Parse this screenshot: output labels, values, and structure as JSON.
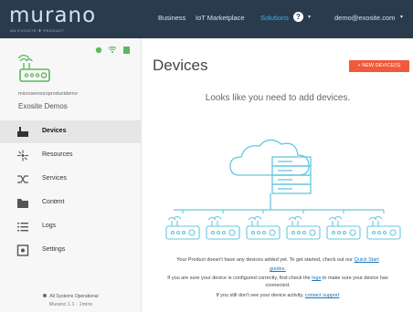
{
  "brand": {
    "name": "murano",
    "tagline": "an exosite ❖ product"
  },
  "nav": {
    "items": [
      "Business",
      "IoT Marketplace",
      "Solutions"
    ],
    "active": "Solutions",
    "help_label": "?",
    "user_email": "demo@exosite.com"
  },
  "sidebar": {
    "product_id": "microsensorsproductdemo",
    "product_name": "Exosite Demos",
    "items": [
      {
        "label": "Devices",
        "icon": "device-icon"
      },
      {
        "label": "Resources",
        "icon": "resources-icon"
      },
      {
        "label": "Services",
        "icon": "services-icon"
      },
      {
        "label": "Content",
        "icon": "folder-icon"
      },
      {
        "label": "Logs",
        "icon": "logs-icon"
      },
      {
        "label": "Settings",
        "icon": "settings-icon"
      }
    ],
    "active": "Devices",
    "status_text": "All Systems Operational",
    "version": "Murano 1.1 - 1mins"
  },
  "main": {
    "title": "Devices",
    "new_button": "+ NEW DEVICE(S)",
    "empty_heading": "Looks like you need to add devices.",
    "info": {
      "line1_text": "Your Product doesn't have any devices added yet. To get started, check out our",
      "line1_link": "Quick Start",
      "line2_link": "guides.",
      "line3_pre": "If you are sure your device is configured correctly, first check the",
      "line3_link": "logs",
      "line3_post": "to make sure your device has",
      "line4": "connected.",
      "line5_text": "If you still don't see your device activity,",
      "line5_link": "contact support"
    }
  },
  "colors": {
    "topbar": "#2a3b4d",
    "accent": "#3ab6e4",
    "button": "#ef5a3a",
    "illustration": "#66c7de"
  }
}
